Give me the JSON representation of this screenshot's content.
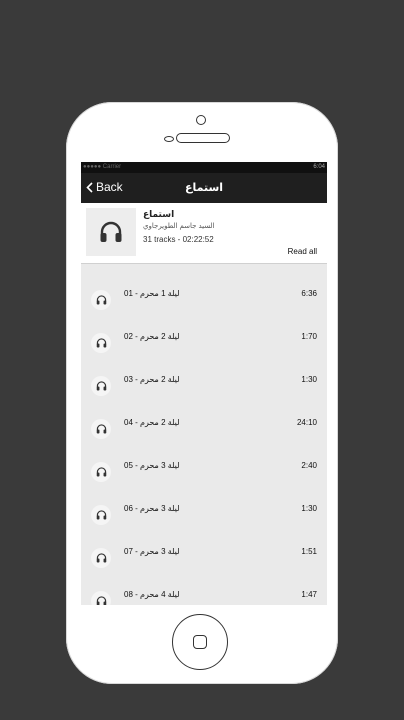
{
  "statusbar": {
    "carrier": "●●●●● Carrier",
    "time": "6:04"
  },
  "nav": {
    "back_label": "Back",
    "title": "استماع"
  },
  "album": {
    "title": "استماع",
    "author": "السيد جاسم الطويرجاوي",
    "tracks_info": "31 tracks - 02:22:52",
    "read_all": "Read all"
  },
  "tracks": [
    {
      "name": "ليلة 1 محرم - 01",
      "duration": "6:36"
    },
    {
      "name": "ليلة 2 محرم - 02",
      "duration": "1:70"
    },
    {
      "name": "ليلة 2 محرم - 03",
      "duration": "1:30"
    },
    {
      "name": "ليلة 2 محرم - 04",
      "duration": "24:10"
    },
    {
      "name": "ليلة 3 محرم - 05",
      "duration": "2:40"
    },
    {
      "name": "ليلة 3 محرم - 06",
      "duration": "1:30"
    },
    {
      "name": "ليلة 3 محرم - 07",
      "duration": "1:51"
    },
    {
      "name": "ليلة 4 محرم - 08",
      "duration": "1:47"
    }
  ],
  "icons": {
    "back": "chevron-left-icon",
    "track": "headphones-icon",
    "album": "headphones-icon"
  }
}
